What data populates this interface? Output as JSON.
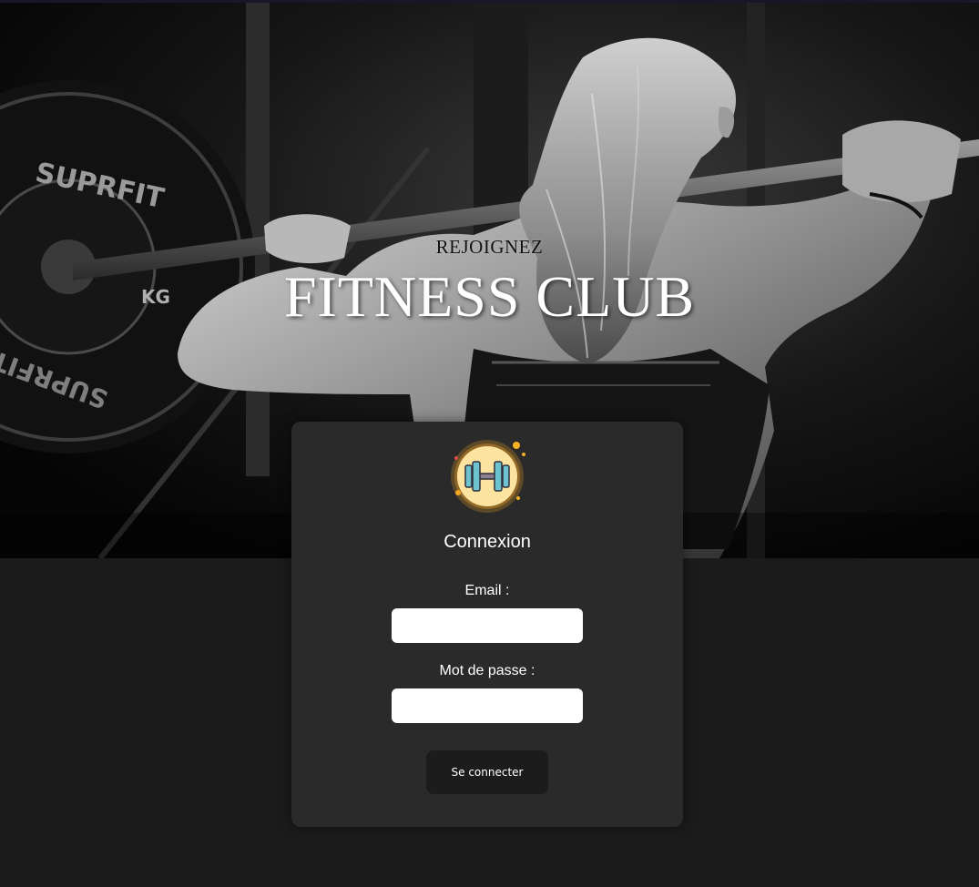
{
  "hero": {
    "subtitle": "REJOIGNEZ",
    "title": "FITNESS CLUB",
    "plate_text_top": "SUPRFIT",
    "plate_text_bottom": "SUPRFIT",
    "plate_unit": "KG"
  },
  "login": {
    "logo_icon": "dumbbell-icon",
    "title": "Connexion",
    "email_label": "Email :",
    "email_value": "",
    "password_label": "Mot de passe :",
    "password_value": "",
    "submit_label": "Se connecter"
  },
  "colors": {
    "page_background": "#1b1b1b",
    "card_background": "#2a2a2a",
    "button_background": "#1c1c1c",
    "logo_circle": "#fde3a0",
    "logo_glow": "#f5a623",
    "dumbbell_plate": "#6cc3cf"
  }
}
